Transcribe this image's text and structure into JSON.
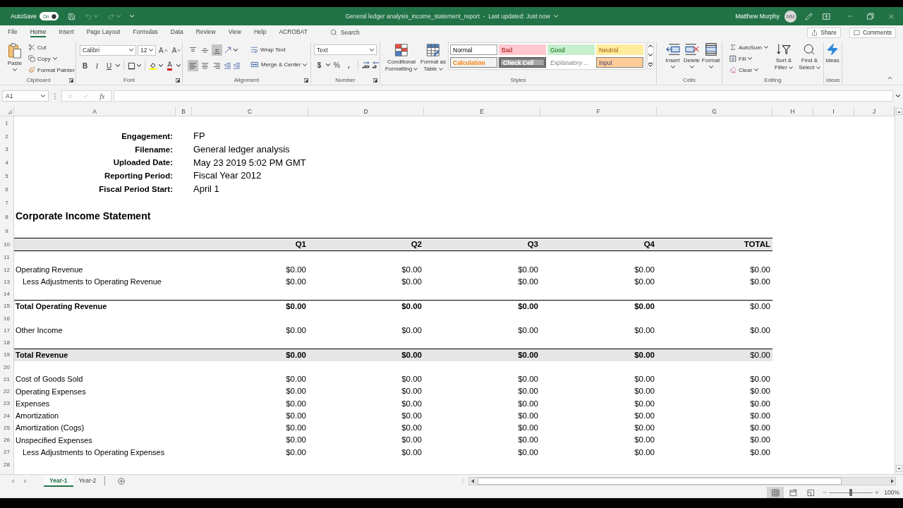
{
  "title_bar": {
    "autosave_label": "AutoSave",
    "autosave": {
      "label": "On",
      "on": true
    },
    "quick_access": [
      {
        "kind": "save",
        "disabled": false
      },
      {
        "kind": "undo",
        "disabled": true
      },
      {
        "kind": "redo",
        "disabled": true
      }
    ],
    "document": "General ledger analysis_income_statement_report  -  Last updated: Just now",
    "user": "Matthew Murphy",
    "initials": "MM"
  },
  "menu_tabs": [
    {
      "label": "File",
      "selected": false
    },
    {
      "label": "Home",
      "selected": true
    },
    {
      "label": "Insert",
      "selected": false
    },
    {
      "label": "Page Layout",
      "selected": false
    },
    {
      "label": "Formulas",
      "selected": false
    },
    {
      "label": "Data",
      "selected": false
    },
    {
      "label": "Review",
      "selected": false
    },
    {
      "label": "View",
      "selected": false
    },
    {
      "label": "Help",
      "selected": false
    },
    {
      "label": "ACROBAT",
      "selected": false
    }
  ],
  "search": {
    "placeholder": "Search"
  },
  "share": "Share",
  "comments": "Comments",
  "ribbon": {
    "clipboard": {
      "label": "Clipboard",
      "paste": "Paste",
      "cut": "Cut",
      "copy": "Copy",
      "format_painter": "Format Painter"
    },
    "font": {
      "label": "Font",
      "name": "Calibri",
      "size": "12",
      "grow": "A",
      "shrink": "A",
      "bold": "B",
      "italic": "I",
      "underline": "U",
      "font_color_label": "A"
    },
    "alignment": {
      "label": "Alignment",
      "vertical": [
        {
          "kind": "top",
          "selected": false
        },
        {
          "kind": "middle",
          "selected": false
        },
        {
          "kind": "bottom",
          "selected": true
        }
      ],
      "horizontal": [
        {
          "kind": "left",
          "selected": true
        },
        {
          "kind": "center",
          "selected": false
        },
        {
          "kind": "right",
          "selected": false
        }
      ],
      "wrap_text": "Wrap Text",
      "merge": "Merge & Center"
    },
    "number": {
      "label": "Number",
      "format": "Text",
      "currency": "$",
      "percent": "%",
      "comma": ","
    },
    "styles": {
      "label": "Styles",
      "conditional": "Conditional Formatting",
      "table": "Format as Table",
      "gallery": [
        {
          "name": "Normal",
          "kind": "normal"
        },
        {
          "name": "Bad",
          "kind": "bad"
        },
        {
          "name": "Good",
          "kind": "good"
        },
        {
          "name": "Neutral",
          "kind": "neutral"
        },
        {
          "name": "Calculation",
          "kind": "calculation"
        },
        {
          "name": "Check Cell",
          "kind": "check"
        },
        {
          "name": "Explanatory ...",
          "kind": "explanatory"
        },
        {
          "name": "Input",
          "kind": "input"
        }
      ]
    },
    "cells": {
      "label": "Cells",
      "buttons": [
        {
          "label": "Insert",
          "kind": "insert"
        },
        {
          "label": "Delete",
          "kind": "delete"
        },
        {
          "label": "Format",
          "kind": "format"
        }
      ]
    },
    "editing": {
      "label": "Editing",
      "autosum": "AutoSum",
      "fill": "Fill",
      "clear": "Clear",
      "sort": "Sort & Filter",
      "find": "Find & Select"
    },
    "ideas": {
      "label": "Ideas",
      "button": "Ideas"
    }
  },
  "formula_bar": {
    "name_box": "A1",
    "function_label": "fx"
  },
  "columns": [
    "A",
    "B",
    "C",
    "D",
    "E",
    "F",
    "G",
    "H",
    "I",
    "J"
  ],
  "rows": [
    {
      "number": "1",
      "kind": "blank"
    },
    {
      "number": "2",
      "kind": "info",
      "label": "Engagement:",
      "value": "FP"
    },
    {
      "number": "3",
      "kind": "info",
      "label": "Filename:",
      "value": "General ledger analysis"
    },
    {
      "number": "4",
      "kind": "info",
      "label": "Uploaded Date:",
      "value": "May 23 2019 5:02 PM GMT"
    },
    {
      "number": "5",
      "kind": "info",
      "label": "Reporting Period:",
      "value": "Fiscal Year 2012"
    },
    {
      "number": "6",
      "kind": "info",
      "label": "Fiscal Period Start:",
      "value": "April 1"
    },
    {
      "number": "7",
      "kind": "blank"
    },
    {
      "number": "8",
      "kind": "title",
      "label": "Corporate Income Statement"
    },
    {
      "number": "9",
      "kind": "blank"
    },
    {
      "number": "10",
      "kind": "header",
      "values": [
        "Q1",
        "Q2",
        "Q3",
        "Q4",
        "TOTAL"
      ]
    },
    {
      "number": "11",
      "kind": "blank"
    },
    {
      "number": "12",
      "kind": "item",
      "label": "Operating Revenue",
      "values": [
        "$0.00",
        "$0.00",
        "$0.00",
        "$0.00",
        "$0.00"
      ]
    },
    {
      "number": "13",
      "kind": "subitem",
      "label": "Less Adjustments to Operating Revenue",
      "values": [
        "$0.00",
        "$0.00",
        "$0.00",
        "$0.00",
        "$0.00"
      ]
    },
    {
      "number": "14",
      "kind": "blank"
    },
    {
      "number": "15",
      "kind": "total",
      "shaded": false,
      "label": "Total Operating Revenue",
      "values": [
        {
          "text": "$0.00",
          "bold": true
        },
        {
          "text": "$0.00",
          "bold": true
        },
        {
          "text": "$0.00",
          "bold": true
        },
        {
          "text": "$0.00",
          "bold": true
        },
        {
          "text": "$0.00",
          "bold": false
        }
      ]
    },
    {
      "number": "16",
      "kind": "blank"
    },
    {
      "number": "17",
      "kind": "item",
      "label": "Other Income",
      "values": [
        "$0.00",
        "$0.00",
        "$0.00",
        "$0.00",
        "$0.00"
      ]
    },
    {
      "number": "18",
      "kind": "blank"
    },
    {
      "number": "19",
      "kind": "total",
      "shaded": true,
      "label": "Total Revenue",
      "values": [
        {
          "text": "$0.00",
          "bold": true
        },
        {
          "text": "$0.00",
          "bold": true
        },
        {
          "text": "$0.00",
          "bold": true
        },
        {
          "text": "$0.00",
          "bold": true
        },
        {
          "text": "$0.00",
          "bold": false
        }
      ]
    },
    {
      "number": "20",
      "kind": "blank"
    },
    {
      "number": "21",
      "kind": "item",
      "label": "Cost of Goods Sold",
      "values": [
        "$0.00",
        "$0.00",
        "$0.00",
        "$0.00",
        "$0.00"
      ]
    },
    {
      "number": "22",
      "kind": "item",
      "label": "Operating Expenses",
      "values": [
        "$0.00",
        "$0.00",
        "$0.00",
        "$0.00",
        "$0.00"
      ]
    },
    {
      "number": "23",
      "kind": "item",
      "label": "Expenses",
      "values": [
        "$0.00",
        "$0.00",
        "$0.00",
        "$0.00",
        "$0.00"
      ]
    },
    {
      "number": "24",
      "kind": "item",
      "label": "Amortization",
      "values": [
        "$0.00",
        "$0.00",
        "$0.00",
        "$0.00",
        "$0.00"
      ]
    },
    {
      "number": "25",
      "kind": "item",
      "label": "Amortization (Cogs)",
      "values": [
        "$0.00",
        "$0.00",
        "$0.00",
        "$0.00",
        "$0.00"
      ]
    },
    {
      "number": "26",
      "kind": "item",
      "label": "Unspecified Expenses",
      "values": [
        "$0.00",
        "$0.00",
        "$0.00",
        "$0.00",
        "$0.00"
      ]
    },
    {
      "number": "27",
      "kind": "subitem",
      "label": "Less Adjustments to Operating Expenses",
      "values": [
        "$0.00",
        "$0.00",
        "$0.00",
        "$0.00",
        "$0.00"
      ]
    },
    {
      "number": "28",
      "kind": "blank"
    }
  ],
  "sheet_tabs": [
    {
      "label": "Year-1",
      "selected": true
    },
    {
      "label": "Year-2",
      "selected": false
    }
  ],
  "status_bar": {
    "views": [
      {
        "kind": "normal",
        "selected": true
      },
      {
        "kind": "page_layout",
        "selected": false
      },
      {
        "kind": "page_break",
        "selected": false
      }
    ],
    "zoom": {
      "level": 0.5,
      "label": "100%"
    }
  }
}
